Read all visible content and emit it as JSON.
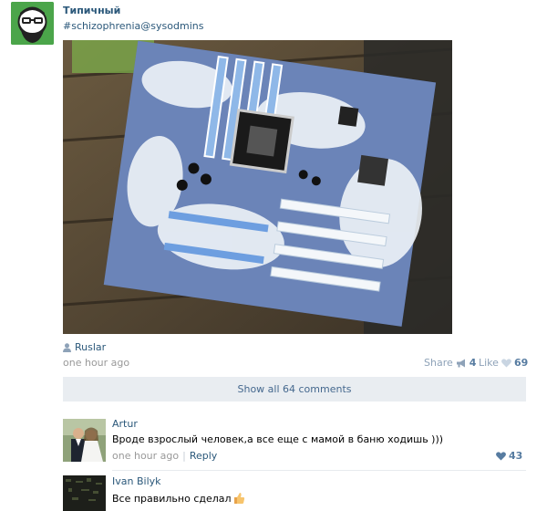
{
  "post": {
    "group_name": "Типичный",
    "group_tags": "#schizophrenia@sysodmins",
    "author": "Ruslar",
    "time": "one hour ago",
    "share_label": "Share",
    "share_count": "4",
    "like_label": "Like",
    "like_count": "69"
  },
  "comments_bar": {
    "show_all": "Show all 64 comments"
  },
  "comments": [
    {
      "name": "Artur",
      "text": "Вроде взрослый человек,а все еще с мамой в баню ходишь )))",
      "time": "one hour ago",
      "reply": "Reply",
      "separator": "|",
      "likes": "43"
    },
    {
      "name": "Ivan Bilyk",
      "text": "Все правильно сделал"
    }
  ],
  "icons": {
    "author": "user-icon",
    "share": "megaphone-icon",
    "like": "heart-icon"
  },
  "colors": {
    "link": "#2b587a",
    "meta": "#999999",
    "count": "#577ca1",
    "bar_bg": "#e9edf1",
    "avatar_green": "#4ba54a"
  }
}
